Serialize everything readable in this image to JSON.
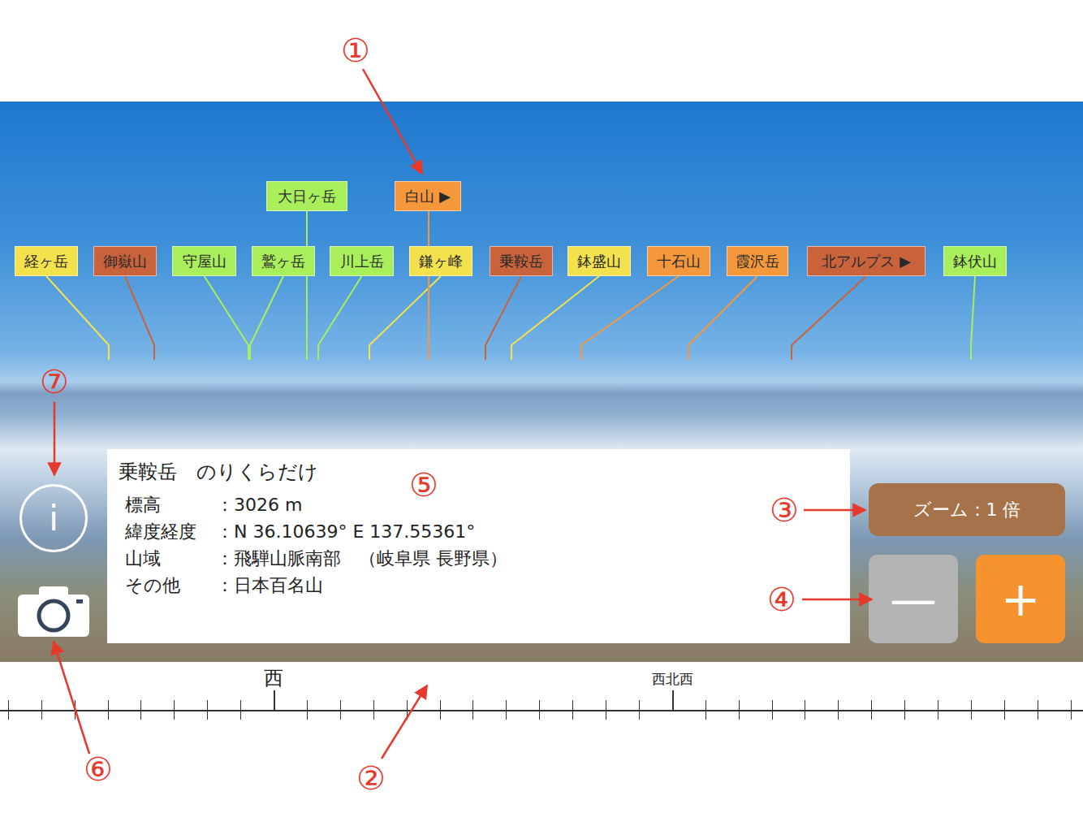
{
  "mountains": [
    {
      "name": "経ヶ岳",
      "color": "#f3e14d"
    },
    {
      "name": "御嶽山",
      "color": "#c9633c"
    },
    {
      "name": "守屋山",
      "color": "#a9ef5c"
    },
    {
      "name": "鷲ヶ岳",
      "color": "#a9ef5c"
    },
    {
      "name": "大日ヶ岳",
      "color": "#a9ef5c"
    },
    {
      "name": "川上岳",
      "color": "#a9ef5c"
    },
    {
      "name": "鎌ヶ峰",
      "color": "#f3e14d"
    },
    {
      "name": "白山 ▶",
      "color": "#f5983c"
    },
    {
      "name": "乗鞍岳",
      "color": "#c9633c"
    },
    {
      "name": "鉢盛山",
      "color": "#f3e14d"
    },
    {
      "name": "十石山",
      "color": "#f5983c"
    },
    {
      "name": "霞沢岳",
      "color": "#f5983c"
    },
    {
      "name": "北アルプス ▶",
      "color": "#c9633c"
    },
    {
      "name": "鉢伏山",
      "color": "#a9ef5c"
    }
  ],
  "info": {
    "title": "乗鞍岳　のりくらだけ",
    "rows": [
      {
        "key": "標高",
        "value": "：3026 m"
      },
      {
        "key": "緯度経度",
        "value": "：N 36.10639° E 137.55361°"
      },
      {
        "key": "山域",
        "value": "：飛騨山脈南部　（岐阜県 長野県）"
      },
      {
        "key": "その他",
        "value": "：日本百名山"
      }
    ]
  },
  "zoom": {
    "label": "ズーム：1 倍"
  },
  "zoom_buttons": [
    {
      "label": "—",
      "kind": "minus"
    },
    {
      "label": "+",
      "kind": "plus"
    }
  ],
  "info_button": {
    "label": "i"
  },
  "compass": {
    "labels": [
      {
        "text": "西",
        "kind": "major"
      },
      {
        "text": "西北西",
        "kind": "minor"
      }
    ]
  },
  "annotations": [
    {
      "label": "①"
    },
    {
      "label": "②"
    },
    {
      "label": "③"
    },
    {
      "label": "④"
    },
    {
      "label": "⑤"
    },
    {
      "label": "⑥"
    },
    {
      "label": "⑦"
    }
  ]
}
